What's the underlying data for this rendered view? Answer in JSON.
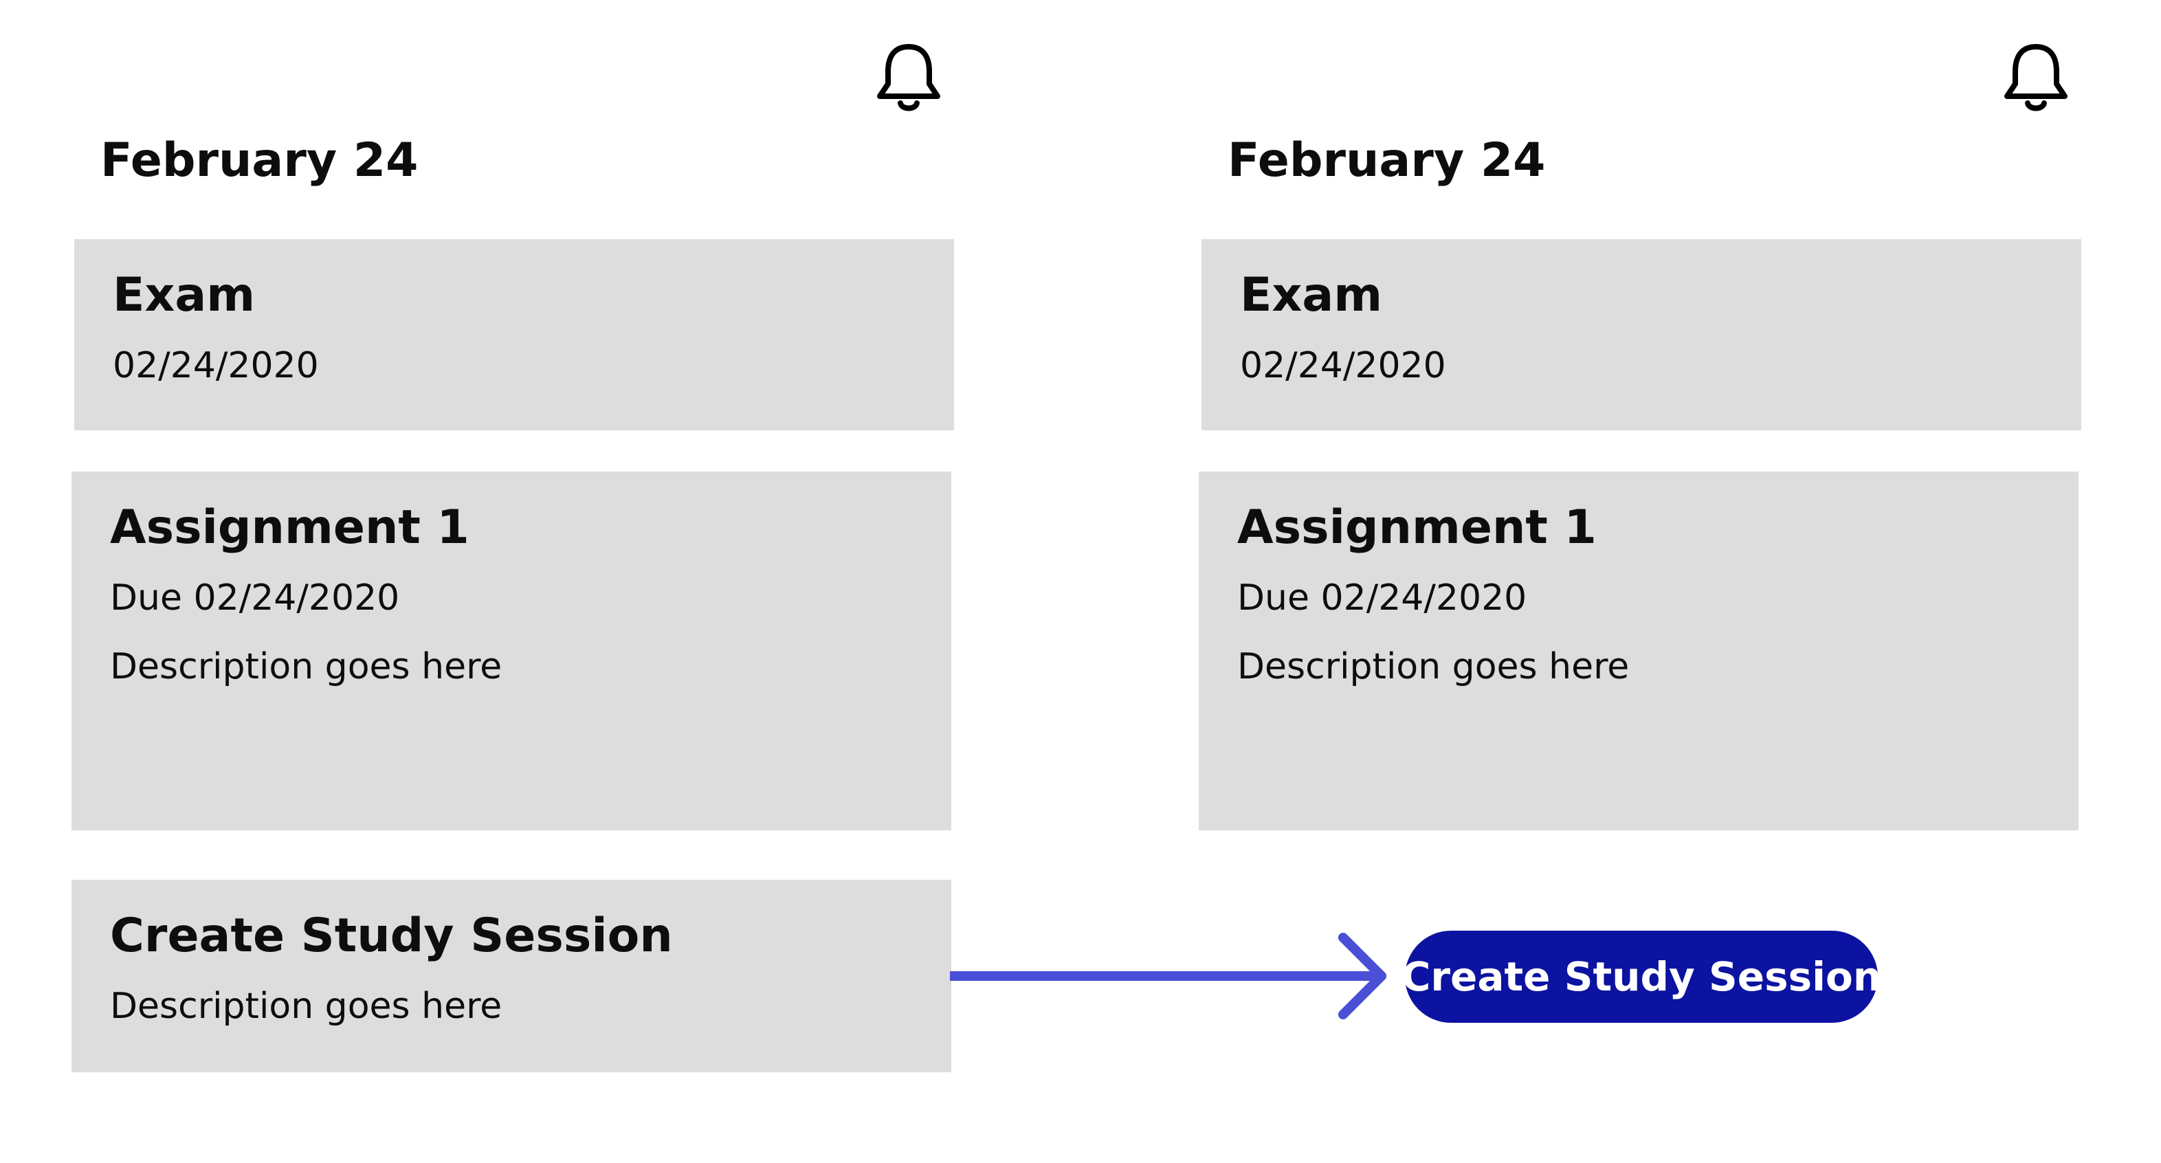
{
  "left": {
    "date_heading": "February 24",
    "bell_icon": "bell-icon",
    "exam": {
      "title": "Exam",
      "date": "02/24/2020"
    },
    "assignment": {
      "title": "Assignment 1",
      "due": "Due 02/24/2020",
      "description": "Description goes here"
    },
    "study_session": {
      "title": "Create Study Session",
      "description": "Description goes here"
    }
  },
  "right": {
    "date_heading": "February 24",
    "bell_icon": "bell-icon",
    "exam": {
      "title": "Exam",
      "date": "02/24/2020"
    },
    "assignment": {
      "title": "Assignment 1",
      "due": "Due 02/24/2020",
      "description": "Description goes here"
    },
    "study_button_label": "Create Study Session"
  },
  "colors": {
    "card_background": "#dddddd",
    "button_background": "#0c13a0",
    "arrow": "#4a4fd6"
  }
}
